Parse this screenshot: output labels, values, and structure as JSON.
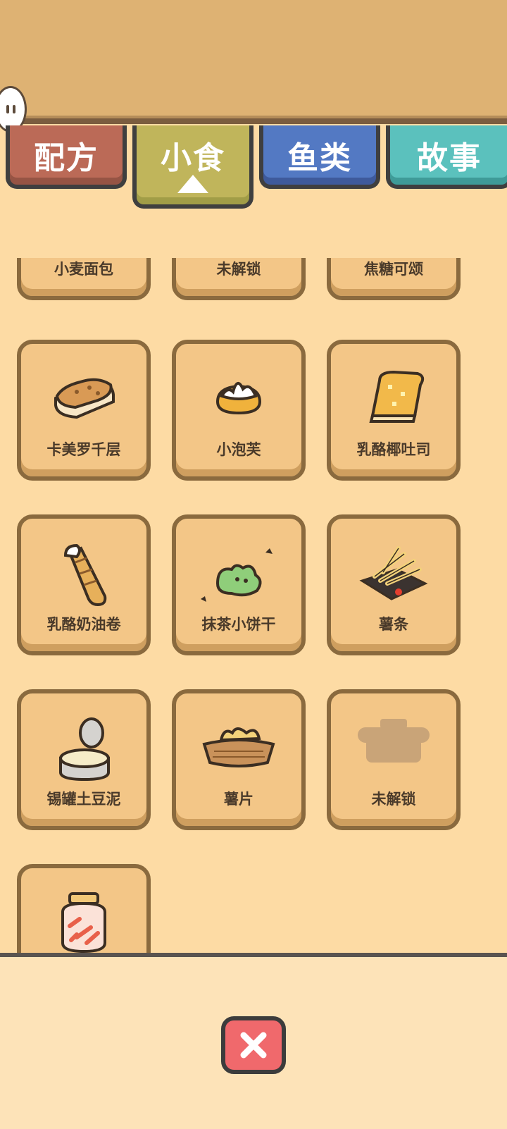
{
  "tabs": [
    {
      "label": "配方"
    },
    {
      "label": "小食"
    },
    {
      "label": "鱼类"
    },
    {
      "label": "故事"
    }
  ],
  "active_tab": "小食",
  "items": [
    {
      "name": "小麦面包",
      "icon": "wheat-bread-icon"
    },
    {
      "name": "未解锁",
      "icon": "locked-icon"
    },
    {
      "name": "焦糖可颂",
      "icon": "caramel-croissant-icon"
    },
    {
      "name": "卡美罗千层",
      "icon": "camelot-mille-feuille-icon"
    },
    {
      "name": "小泡芙",
      "icon": "cream-puff-icon"
    },
    {
      "name": "乳酪椰吐司",
      "icon": "cheese-coconut-toast-icon"
    },
    {
      "name": "乳酪奶油卷",
      "icon": "cheese-cream-roll-icon"
    },
    {
      "name": "抹茶小饼干",
      "icon": "matcha-cookie-icon"
    },
    {
      "name": "薯条",
      "icon": "french-fries-icon"
    },
    {
      "name": "锡罐土豆泥",
      "icon": "tin-mashed-potato-icon"
    },
    {
      "name": "薯片",
      "icon": "potato-chips-icon"
    },
    {
      "name": "未解锁",
      "icon": "locked-pot-icon"
    },
    {
      "name": "",
      "icon": "pickle-jar-icon"
    }
  ],
  "close_icon": "close-icon"
}
